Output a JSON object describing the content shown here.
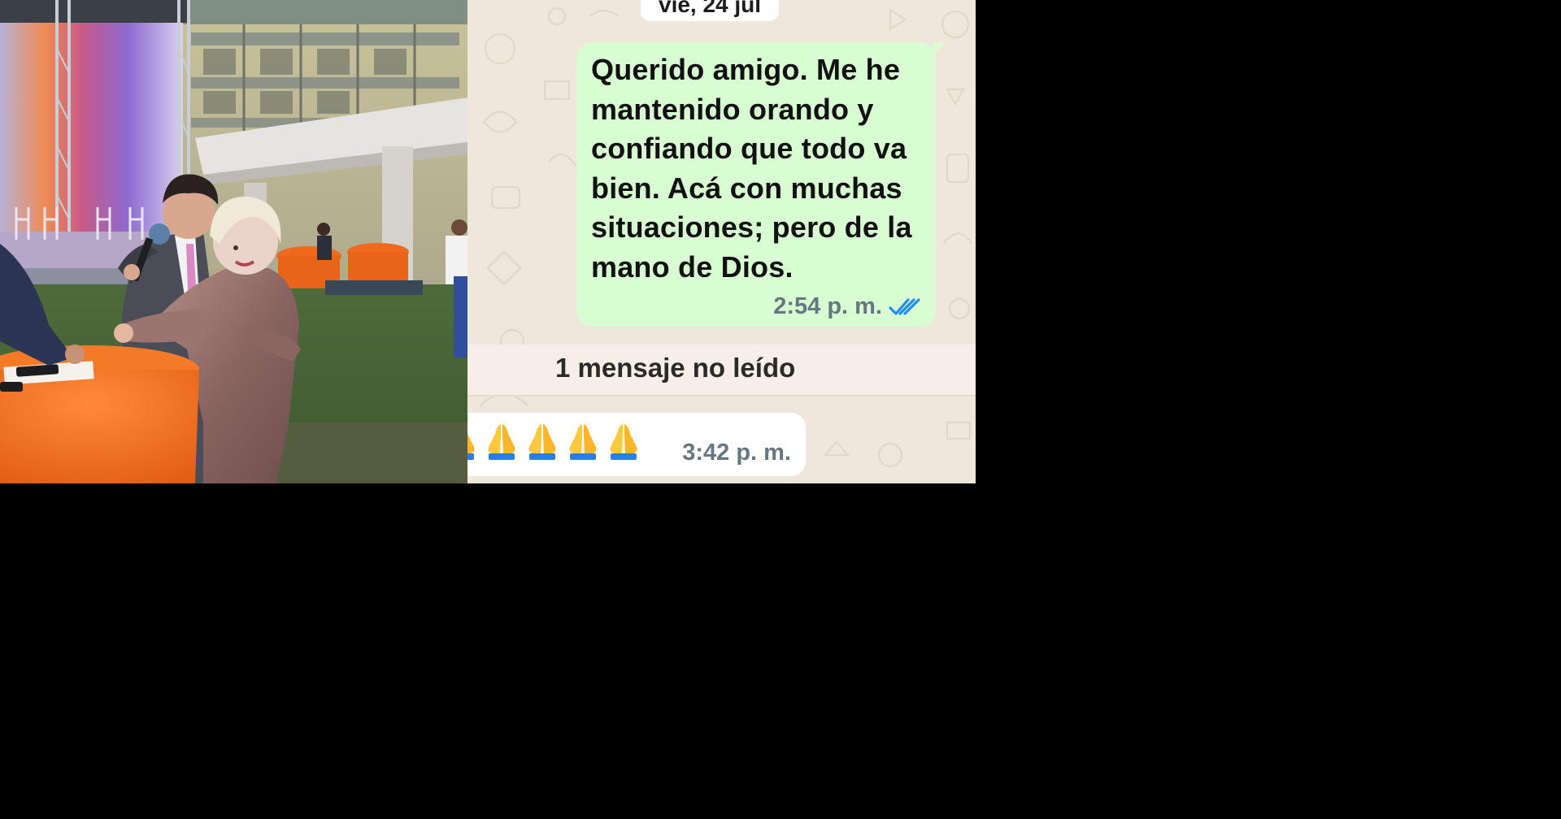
{
  "chat": {
    "date_label": "vie, 24 jul",
    "outgoing": {
      "lines": [
        "Querido amigo.  Me he",
        "mantenido orando y",
        "confiando que todo va",
        "bien.  Acá con muchas",
        "situaciones; pero de la",
        "mano de Dios."
      ],
      "time": "2:54 p. m.",
      "status_icon": "double-check-read-icon"
    },
    "unread_banner": "1 mensaje no leído",
    "incoming": {
      "emoji": "pray-emoji",
      "emoji_count_visible": 5,
      "time": "3:42 p. m."
    }
  },
  "colors": {
    "page_background": "#000000",
    "chat_background": "#efe7dc",
    "outgoing_bubble": "#d9fdd3",
    "incoming_bubble": "#ffffff",
    "read_ticks": "#1f8ef1",
    "meta_text": "#667781"
  }
}
